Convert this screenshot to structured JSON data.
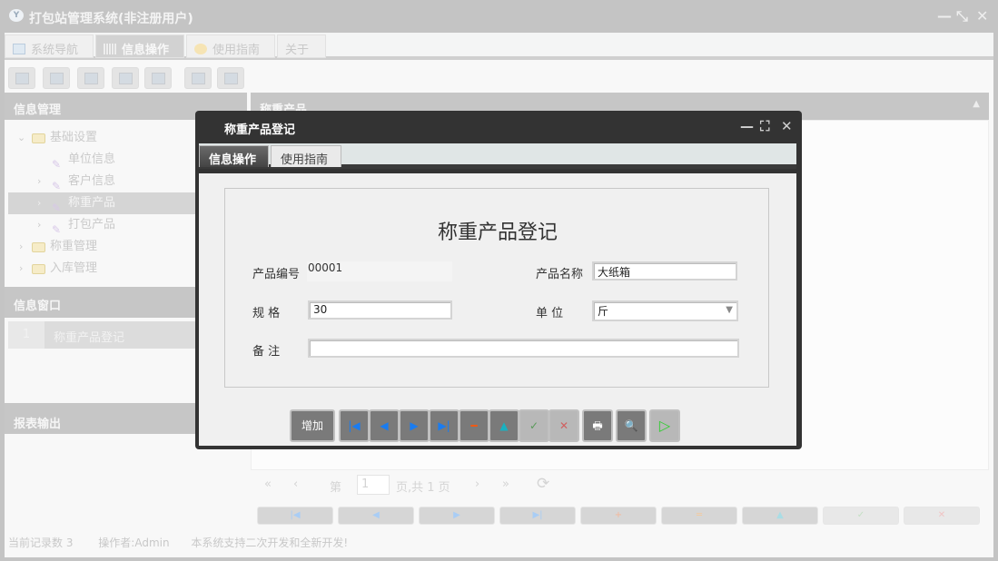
{
  "app": {
    "title": "打包站管理系统(非注册用户)"
  },
  "main_tabs": [
    {
      "label": "系统导航"
    },
    {
      "label": "信息操作"
    },
    {
      "label": "使用指南"
    },
    {
      "label": "关于"
    }
  ],
  "toolbar_icons": [
    "search-icon",
    "list-icon",
    "document-icon",
    "user-icon",
    "screen-icon",
    "window-add-icon",
    "window-icon"
  ],
  "left": {
    "info_mgmt": {
      "title": "信息管理",
      "tree": [
        {
          "label": "基础设置",
          "level": 0,
          "type": "folder",
          "expanded": true
        },
        {
          "label": "单位信息",
          "level": 1,
          "type": "leaf"
        },
        {
          "label": "客户信息",
          "level": 1,
          "type": "leaf"
        },
        {
          "label": "称重产品",
          "level": 1,
          "type": "leaf",
          "selected": true
        },
        {
          "label": "打包产品",
          "level": 1,
          "type": "leaf"
        },
        {
          "label": "称重管理",
          "level": 0,
          "type": "folder"
        },
        {
          "label": "入库管理",
          "level": 0,
          "type": "folder"
        }
      ]
    },
    "info_window": {
      "title": "信息窗口",
      "rows": [
        {
          "num": "1",
          "label": "称重产品登记"
        }
      ]
    },
    "report": {
      "title": "报表输出"
    }
  },
  "right": {
    "title": "称重产品",
    "pager": {
      "page_label": "第",
      "page": "1",
      "total_label": "页,共 1 页"
    }
  },
  "status": {
    "records": "当前记录数 3",
    "operator": "操作者:Admin",
    "note": "本系统支持二次开发和全新开发!"
  },
  "dialog": {
    "title": "称重产品登记",
    "tabs": [
      {
        "label": "信息操作"
      },
      {
        "label": "使用指南"
      }
    ],
    "form_title": "称重产品登记",
    "fields": {
      "code_label": "产品编号",
      "code": "00001",
      "name_label": "产品名称",
      "name": "大纸箱",
      "spec_label": "规 格",
      "spec": "30",
      "unit_label": "单 位",
      "unit": "斤",
      "remark_label": "备 注",
      "remark": ""
    },
    "add_label": "增加"
  },
  "colors": {
    "dialog_bar": "#333333",
    "overlay": "#c4c4c4",
    "nav_blue": "#1a7cf0"
  }
}
